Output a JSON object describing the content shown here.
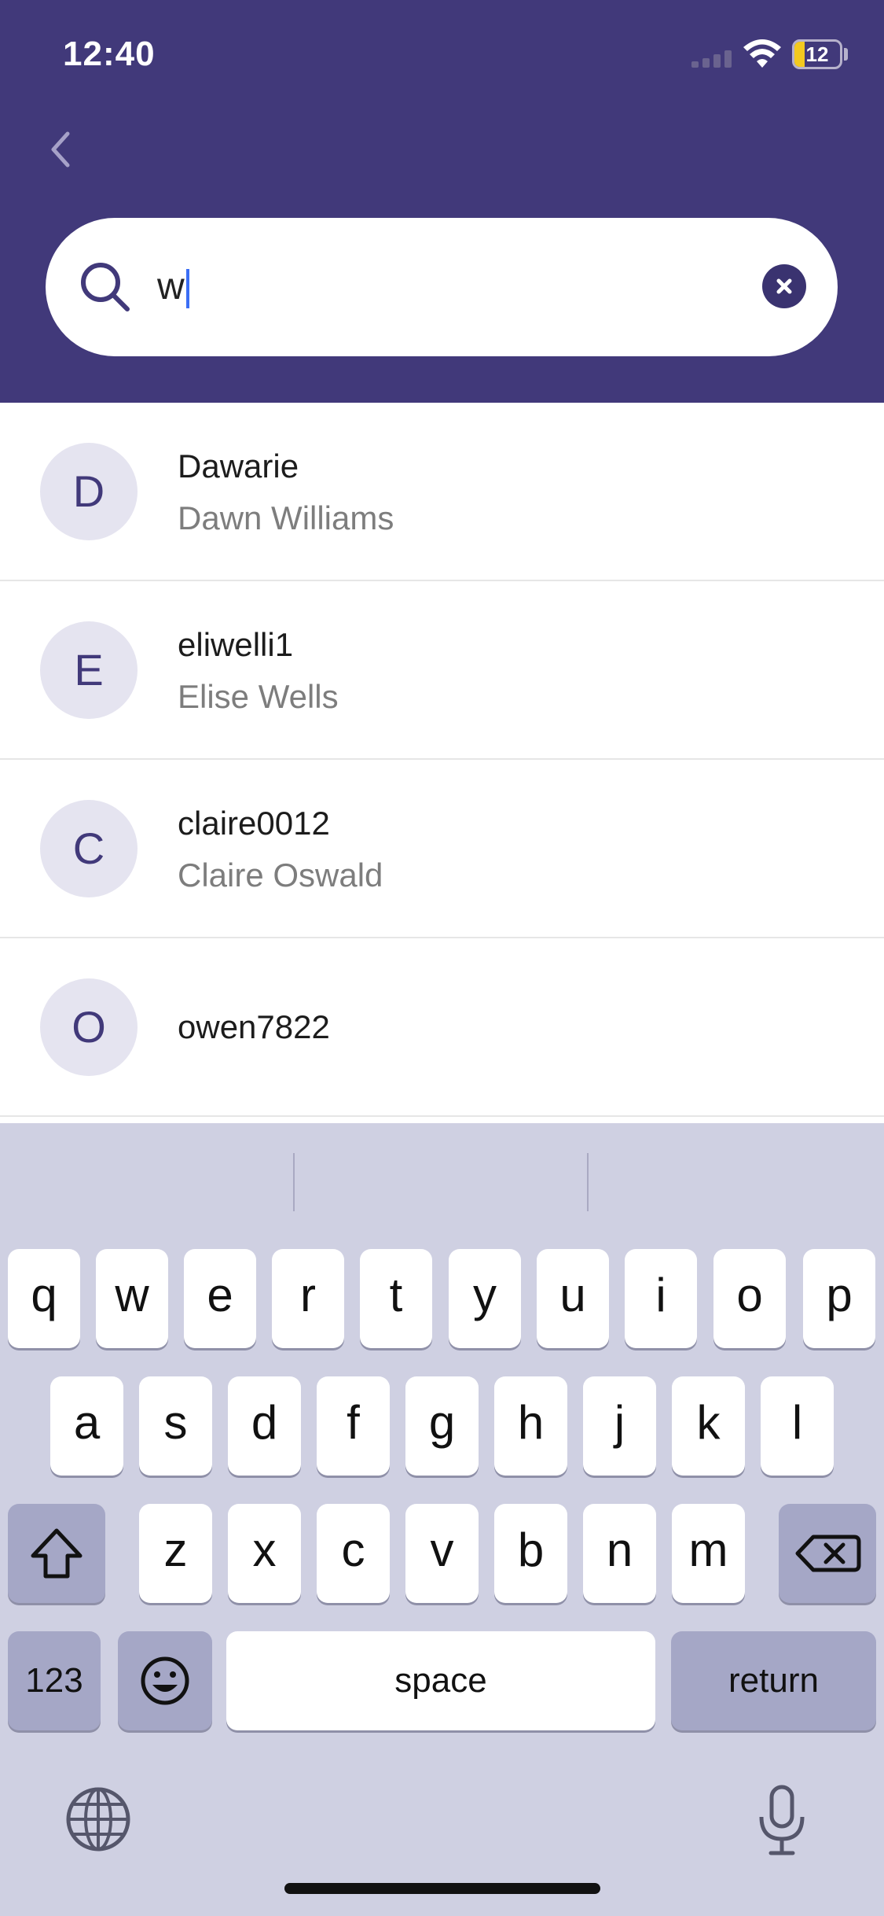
{
  "status_bar": {
    "time": "12:40",
    "battery": "12"
  },
  "search": {
    "value": "w"
  },
  "results": [
    {
      "initial": "D",
      "username": "Dawarie",
      "full_name": "Dawn Williams"
    },
    {
      "initial": "E",
      "username": "eliwelli1",
      "full_name": "Elise Wells"
    },
    {
      "initial": "C",
      "username": "claire0012",
      "full_name": "Claire Oswald"
    },
    {
      "initial": "O",
      "username": "owen7822",
      "full_name": ""
    }
  ],
  "keyboard": {
    "row1": [
      "q",
      "w",
      "e",
      "r",
      "t",
      "y",
      "u",
      "i",
      "o",
      "p"
    ],
    "row2": [
      "a",
      "s",
      "d",
      "f",
      "g",
      "h",
      "j",
      "k",
      "l"
    ],
    "row3": [
      "z",
      "x",
      "c",
      "v",
      "b",
      "n",
      "m"
    ],
    "numbers_label": "123",
    "space_label": "space",
    "return_label": "return"
  },
  "colors": {
    "header": "#41397a",
    "avatar_bg": "#e5e4f0",
    "caret": "#3b6ef5",
    "keyboard_bg": "#cfd0e2"
  },
  "icons": [
    "back-chevron-icon",
    "search-icon",
    "clear-icon",
    "shift-icon",
    "backspace-icon",
    "emoji-icon",
    "globe-icon",
    "microphone-icon"
  ]
}
